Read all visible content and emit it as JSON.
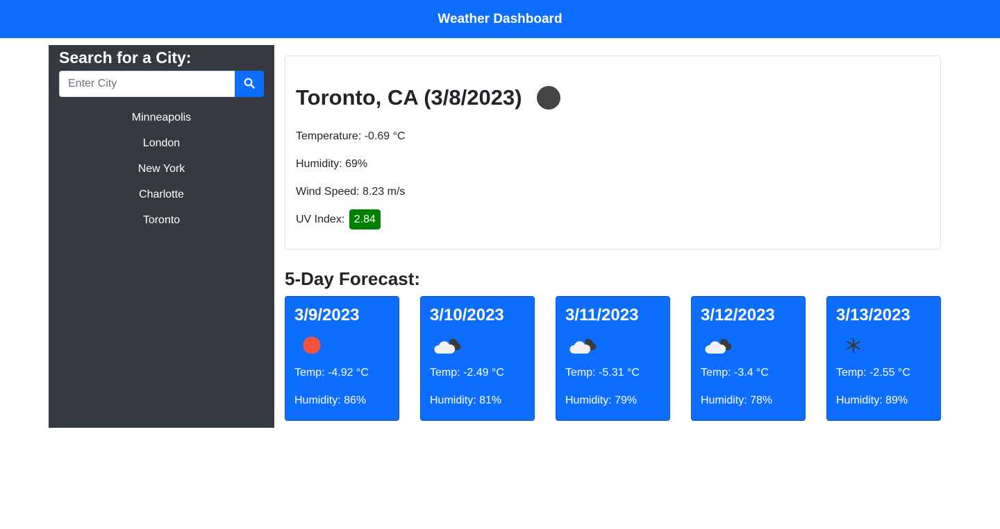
{
  "header": {
    "title": "Weather Dashboard"
  },
  "sidebar": {
    "title": "Search for a City:",
    "search": {
      "placeholder": "Enter City",
      "value": "",
      "button_icon": "search-icon"
    },
    "history": [
      "Minneapolis",
      "London",
      "New York",
      "Charlotte",
      "Toronto"
    ]
  },
  "current": {
    "title": "Toronto, CA (3/8/2023)",
    "icon": "cloudy-night-icon",
    "temperature": "Temperature: -0.69 °C",
    "humidity": "Humidity: 69%",
    "wind": "Wind Speed: 8.23 m/s",
    "uv_label": "UV Index:",
    "uv_value": "2.84",
    "uv_color": "#008000"
  },
  "forecast": {
    "title": "5-Day Forecast:",
    "days": [
      {
        "date": "3/9/2023",
        "icon": "sun-icon",
        "temp": "Temp: -4.92 °C",
        "humidity": "Humidity: 86%"
      },
      {
        "date": "3/10/2023",
        "icon": "cloud-icon",
        "temp": "Temp: -2.49 °C",
        "humidity": "Humidity: 81%"
      },
      {
        "date": "3/11/2023",
        "icon": "cloud-icon",
        "temp": "Temp: -5.31 °C",
        "humidity": "Humidity: 79%"
      },
      {
        "date": "3/12/2023",
        "icon": "cloud-icon",
        "temp": "Temp: -3.4 °C",
        "humidity": "Humidity: 78%"
      },
      {
        "date": "3/13/2023",
        "icon": "snow-icon",
        "temp": "Temp: -2.55 °C",
        "humidity": "Humidity: 89%"
      }
    ]
  },
  "colors": {
    "primary": "#0d6efd",
    "sidebar_bg": "#343a40",
    "uv_badge": "#008000"
  }
}
